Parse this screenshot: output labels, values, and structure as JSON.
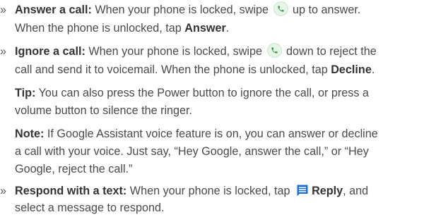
{
  "bullet_marker": "»",
  "items": [
    {
      "title": "Answer a call:",
      "line1_a": "When your phone is locked, swipe",
      "line1_b": "up to answer.",
      "line2_a": "When the phone is unlocked, tap",
      "line2_bold": "Answer",
      "line2_end": ".",
      "icon": "phone-green-icon"
    },
    {
      "title": "Ignore a call:",
      "line1_a": "When your phone is locked, swipe",
      "line1_b": "down to reject the",
      "line2_a": "call and send it to voicemail. When the phone is unlocked, tap",
      "line2_bold": "Decline",
      "line2_end": ".",
      "icon": "phone-green-icon"
    }
  ],
  "tip": {
    "label": "Tip:",
    "line1": "You can also press the Power button to ignore the call, or press a",
    "line2": "volume button to silence the ringer."
  },
  "note": {
    "label": "Note:",
    "line1": "If Google Assistant voice feature is on, you can answer or decline",
    "line2": "a call with your voice. Just say, “Hey Google, answer the call,” or “Hey",
    "line3": "Google, reject the call.”"
  },
  "respond": {
    "title": "Respond with a text:",
    "line1_a": "When your phone is locked, tap",
    "reply_label": "Reply",
    "line1_b": ", and",
    "line2": "select a message to respond.",
    "icon": "message-blue-icon"
  },
  "colors": {
    "text": "#4a4a4a",
    "bold": "#333333",
    "phone_icon_green": "#3a9a4a",
    "message_icon_blue": "#1f6fd1"
  }
}
